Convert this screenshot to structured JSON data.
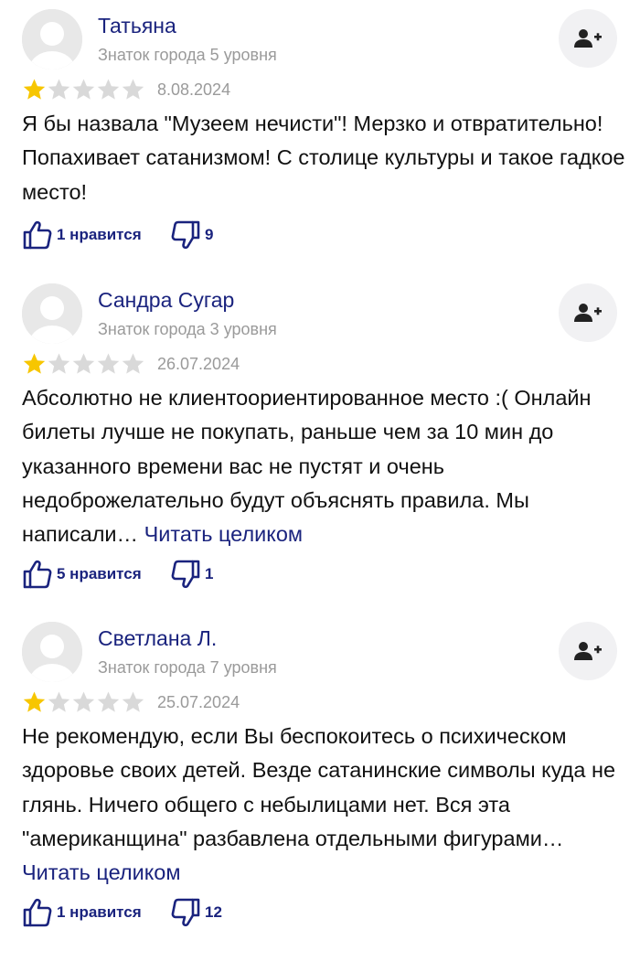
{
  "reviews": [
    {
      "author": "Татьяна",
      "level": "Знаток города 5 уровня",
      "rating": 1,
      "date": "8.08.2024",
      "text": "Я бы назвала \"Музеем нечисти\"! Мерзко и отвратительно! Попахивает сатанизмом! С столице культуры и такое гадкое место!",
      "more": "",
      "likes": "1 нравится",
      "dislikes": "9"
    },
    {
      "author": "Сандра Сугар",
      "level": "Знаток города 3 уровня",
      "rating": 1,
      "date": "26.07.2024",
      "text": "Абсолютно не клиентоориентированное место :( Онлайн билеты лучше не покупать, раньше чем за 10 мин до указанного времени вас не пустят и очень недоброжелательно будут объяснять правила. Мы написали… ",
      "more": "Читать целиком",
      "likes": "5 нравится",
      "dislikes": "1"
    },
    {
      "author": "Светлана Л.",
      "level": "Знаток города 7 уровня",
      "rating": 1,
      "date": "25.07.2024",
      "text": "Не рекомендую, если Вы беспокоитесь о психическом здоровье своих детей. Везде сатанинские символы куда не глянь. Ничего общего с небылицами нет. Вся эта \"американщина\" разбавлена отдельными фигурами… ",
      "more": "Читать целиком",
      "likes": "1 нравится",
      "dislikes": "12"
    }
  ],
  "icons": {
    "avatar": "user-placeholder-icon",
    "subscribe": "add-user-icon",
    "like": "thumbs-up-icon",
    "dislike": "thumbs-down-icon",
    "star": "star-icon"
  },
  "colors": {
    "link": "#1a237e",
    "star_filled": "#f7c600",
    "star_empty": "#d9d9d9",
    "secondary_text": "#9a9a9a"
  }
}
